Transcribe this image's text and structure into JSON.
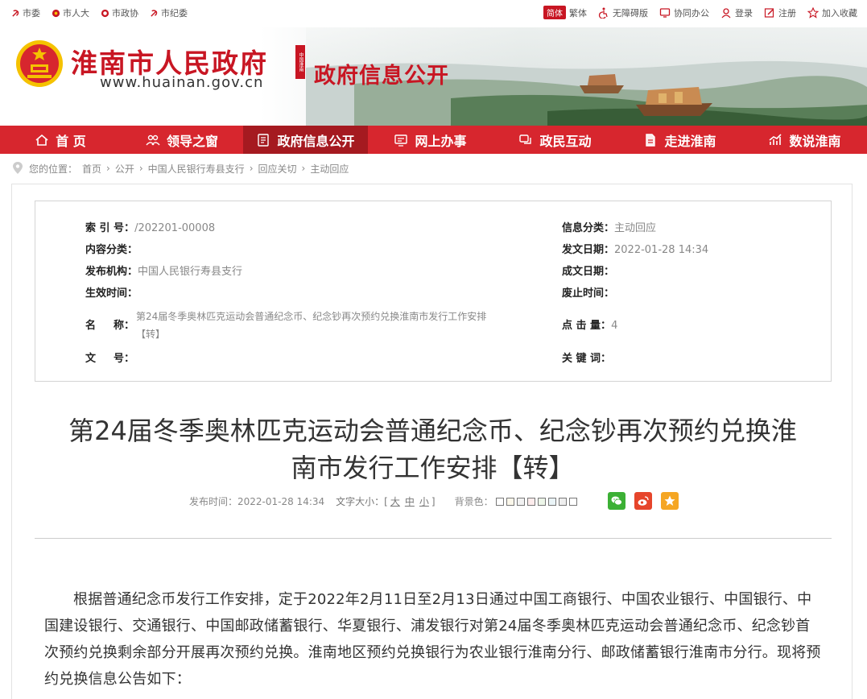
{
  "topbar": {
    "left_links": [
      "市委",
      "市人大",
      "市政协",
      "市纪委"
    ],
    "lang_simplified": "简体",
    "lang_traditional": "繁体",
    "accessible": "无障碍版",
    "office": "协同办公",
    "login": "登录",
    "register": "注册",
    "favorite": "加入收藏"
  },
  "banner": {
    "site_name": "淮南市人民政府",
    "site_url": "www.huainan.gov.cn",
    "seal_text": "中国淮南",
    "section_name": "政府信息公开"
  },
  "nav": {
    "items": [
      "首 页",
      "领导之窗",
      "政府信息公开",
      "网上办事",
      "政民互动",
      "走进淮南",
      "数说淮南"
    ],
    "active_index": 2
  },
  "breadcrumb": {
    "prefix": "您的位置：",
    "items": [
      "首页",
      "公开",
      "中国人民银行寿县支行",
      "回应关切",
      "主动回应"
    ],
    "separator": "›"
  },
  "meta": {
    "index_label": "索 引 号：",
    "index_value": "/202201-00008",
    "category_label": "信息分类：",
    "category_value": "主动回应",
    "content_label": "内容分类：",
    "content_value": "",
    "issue_date_label": "发文日期：",
    "issue_date_value": "2022-01-28 14:34",
    "publisher_label": "发布机构：",
    "publisher_value": "中国人民银行寿县支行",
    "written_date_label": "成文日期：",
    "written_date_value": "",
    "effective_label": "生效时间：",
    "effective_value": "",
    "abolish_label": "废止时间：",
    "abolish_value": "",
    "name_label_1": "名",
    "name_label_2": "称：",
    "name_value_line1": "第24届冬季奥林匹克运动会普通纪念币、纪念钞再次预约兑换淮南市发行工作安排",
    "name_value_line2": "【转】",
    "clicks_label": "点 击 量：",
    "clicks_value": "4",
    "doc_no_label_1": "文",
    "doc_no_label_2": "号：",
    "doc_no_value": "",
    "keywords_label": "关 键 词：",
    "keywords_value": ""
  },
  "article": {
    "title_line1": "第24届冬季奥林匹克运动会普通纪念币、纪念钞再次预约兑换淮",
    "title_line2": "南市发行工作安排【转】",
    "publish_label": "发布时间：2022-01-28 14:34",
    "font_size_label": "文字大小：[",
    "font_large": "大",
    "font_medium": "中",
    "font_small": "小",
    "font_size_close": "]",
    "bg_color_label": "背景色：",
    "bg_swatches": [
      "#ffffff",
      "#fbf7ea",
      "#f2f2f2",
      "#fdecec",
      "#edf6e9",
      "#eaf4f7",
      "#eeeeee",
      "#ffffff"
    ],
    "paragraph": "根据普通纪念币发行工作安排，定于2022年2月11日至2月13日通过中国工商银行、中国农业银行、中国银行、中国建设银行、交通银行、中国邮政储蓄银行、华夏银行、浦发银行对第24届冬季奥林匹克运动会普通纪念币、纪念钞首次预约兑换剩余部分开展再次预约兑换。淮南地区预约兑换银行为农业银行淮南分行、邮政储蓄银行淮南市分行。现将预约兑换信息公告如下："
  },
  "colors": {
    "brand_red": "#c81623",
    "nav_red": "#d7262e",
    "nav_active": "#a51a20",
    "wechat": "#3cb035",
    "weibo": "#e6452b",
    "favorite": "#f5a623"
  }
}
